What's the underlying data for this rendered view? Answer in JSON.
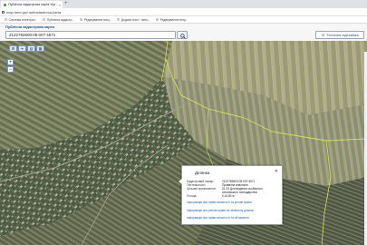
{
  "browser": {
    "tabs": [
      {
        "title": "Публічна кадастрова карта Укр...",
        "active": true
      }
    ],
    "new_tab": "+",
    "url": "map.land.gov.ua/kadastrova-karta",
    "bookmarks": [
      "Система електрон...",
      "Публічна кадастр...",
      "Редагування полу...",
      "Додати пост › авто...",
      "Редагування полу..."
    ]
  },
  "site": {
    "logo": "Публічна кадастрова карта",
    "search_value": "2122782600:05:007:4571",
    "help_label": "Технічна підтримка"
  },
  "map_tools": [
    "⊞",
    "⌖",
    "▤",
    "▦"
  ],
  "zoom": {
    "in": "+",
    "out": "−"
  },
  "popup": {
    "title": "Ділянка",
    "close": "✕",
    "rows": [
      {
        "label": "Кадастровий номер:",
        "value": "2122782600:05:007:4571"
      },
      {
        "label": "Тип власності:",
        "value": "Приватна власність"
      },
      {
        "label": "Цільове призначення:",
        "value": "01.03 Для ведення особистого"
      },
      {
        "label": "",
        "value": "селянського господарства"
      },
      {
        "label": "Площа:",
        "value": "0.1418 га"
      }
    ],
    "links": [
      "Інформація про право власності та речові права",
      "Інформація про речові права на земельну ділянку",
      "Інформація про право власності та обтяження"
    ]
  },
  "colors": {
    "parcel_outline": "#7fc4ee",
    "boundary": "#d4e05a"
  }
}
